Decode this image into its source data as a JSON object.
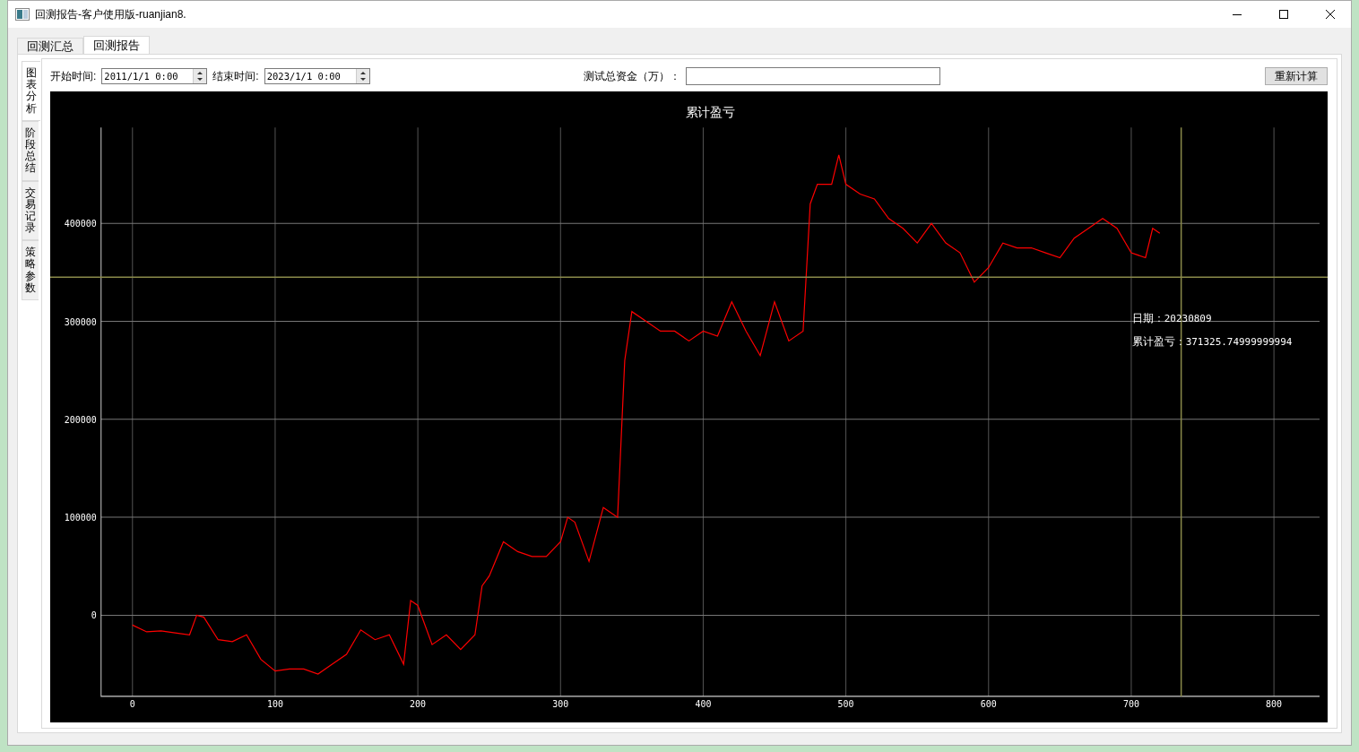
{
  "window": {
    "title": "回测报告-客户使用版-ruanjian8."
  },
  "tabs": [
    {
      "label": "回测汇总",
      "selected": false
    },
    {
      "label": "回测报告",
      "selected": true
    }
  ],
  "side_tabs": [
    {
      "label": "图表分析",
      "selected": true
    },
    {
      "label": "阶段总结",
      "selected": false
    },
    {
      "label": "交易记录",
      "selected": false
    },
    {
      "label": "策略参数",
      "selected": false
    }
  ],
  "toolbar": {
    "start_label": "开始时间:",
    "start_value": "2011/1/1 0:00",
    "end_label": "结束时间:",
    "end_value": "2023/1/1 0:00",
    "capital_label": "测试总资金（万）：",
    "recalc_button": "重新计算"
  },
  "chart": {
    "chart_data": {
      "type": "line",
      "title": "累计盈亏",
      "grid": true,
      "xlim": [
        -22,
        832
      ],
      "ylim": [
        -82800,
        498000
      ],
      "xticks": [
        0,
        100,
        200,
        300,
        400,
        500,
        600,
        700,
        800
      ],
      "yticks": [
        0,
        100000,
        200000,
        300000,
        400000
      ],
      "x": [
        0,
        10,
        20,
        30,
        40,
        45,
        50,
        60,
        70,
        80,
        90,
        100,
        110,
        120,
        130,
        140,
        150,
        160,
        170,
        180,
        190,
        195,
        200,
        210,
        220,
        230,
        240,
        245,
        250,
        260,
        270,
        280,
        290,
        300,
        305,
        310,
        320,
        330,
        340,
        345,
        350,
        360,
        370,
        380,
        390,
        400,
        410,
        420,
        430,
        440,
        450,
        460,
        470,
        475,
        480,
        490,
        495,
        500,
        510,
        520,
        530,
        540,
        550,
        560,
        570,
        580,
        590,
        600,
        610,
        620,
        630,
        640,
        650,
        660,
        670,
        680,
        690,
        700,
        710,
        715,
        720
      ],
      "series": [
        {
          "color": "#ff0000",
          "values": [
            -10000,
            -17000,
            -16000,
            -18000,
            -20000,
            0,
            -2000,
            -25000,
            -27000,
            -20000,
            -45000,
            -57000,
            -55000,
            -55000,
            -60000,
            -50000,
            -40000,
            -15000,
            -25000,
            -20000,
            -50000,
            15000,
            10000,
            -30000,
            -20000,
            -35000,
            -20000,
            30000,
            40000,
            75000,
            65000,
            60000,
            60000,
            75000,
            100000,
            95000,
            55000,
            110000,
            100000,
            260000,
            310000,
            300000,
            290000,
            290000,
            280000,
            290000,
            285000,
            320000,
            290000,
            265000,
            320000,
            280000,
            290000,
            420000,
            440000,
            440000,
            470000,
            440000,
            430000,
            425000,
            405000,
            395000,
            380000,
            400000,
            380000,
            370000,
            340000,
            355000,
            380000,
            375000,
            375000,
            370000,
            365000,
            385000,
            395000,
            405000,
            395000,
            370000,
            365000,
            395000,
            390000
          ]
        }
      ],
      "ref_lines": [
        {
          "axis": "x",
          "value": 735,
          "color": "#8a8a4a"
        },
        {
          "axis": "y",
          "value": 345000,
          "color": "#8a8a4a"
        }
      ]
    },
    "tooltip": {
      "date_label": "日期：",
      "date": "20230809",
      "value_label": "累计盈亏：",
      "value": "371325.74999999994"
    }
  }
}
